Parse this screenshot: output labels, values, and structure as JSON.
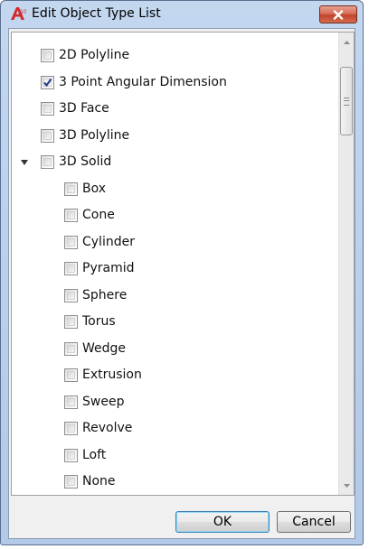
{
  "window": {
    "title": "Edit Object Type List",
    "icon": "autocad-app-icon",
    "close_icon": "close-icon"
  },
  "list": {
    "items": [
      {
        "label": "2D Polyline",
        "checked": false,
        "level": 0,
        "expandable": false
      },
      {
        "label": "3 Point Angular Dimension",
        "checked": true,
        "level": 0,
        "expandable": false
      },
      {
        "label": "3D Face",
        "checked": false,
        "level": 0,
        "expandable": false
      },
      {
        "label": "3D Polyline",
        "checked": false,
        "level": 0,
        "expandable": false
      },
      {
        "label": "3D Solid",
        "checked": false,
        "level": 0,
        "expandable": true,
        "expanded": true
      },
      {
        "label": "Box",
        "checked": false,
        "level": 1,
        "expandable": false
      },
      {
        "label": "Cone",
        "checked": false,
        "level": 1,
        "expandable": false
      },
      {
        "label": "Cylinder",
        "checked": false,
        "level": 1,
        "expandable": false
      },
      {
        "label": "Pyramid",
        "checked": false,
        "level": 1,
        "expandable": false
      },
      {
        "label": "Sphere",
        "checked": false,
        "level": 1,
        "expandable": false
      },
      {
        "label": "Torus",
        "checked": false,
        "level": 1,
        "expandable": false
      },
      {
        "label": "Wedge",
        "checked": false,
        "level": 1,
        "expandable": false
      },
      {
        "label": "Extrusion",
        "checked": false,
        "level": 1,
        "expandable": false
      },
      {
        "label": "Sweep",
        "checked": false,
        "level": 1,
        "expandable": false
      },
      {
        "label": "Revolve",
        "checked": false,
        "level": 1,
        "expandable": false
      },
      {
        "label": "Loft",
        "checked": false,
        "level": 1,
        "expandable": false
      },
      {
        "label": "None",
        "checked": false,
        "level": 1,
        "expandable": false
      }
    ]
  },
  "buttons": {
    "ok_label": "OK",
    "cancel_label": "Cancel"
  },
  "colors": {
    "title_bar": "#c3d7ef",
    "close_button": "#c0432b",
    "check_mark": "#1d3a7a",
    "default_button_border": "#3c7fb1"
  }
}
